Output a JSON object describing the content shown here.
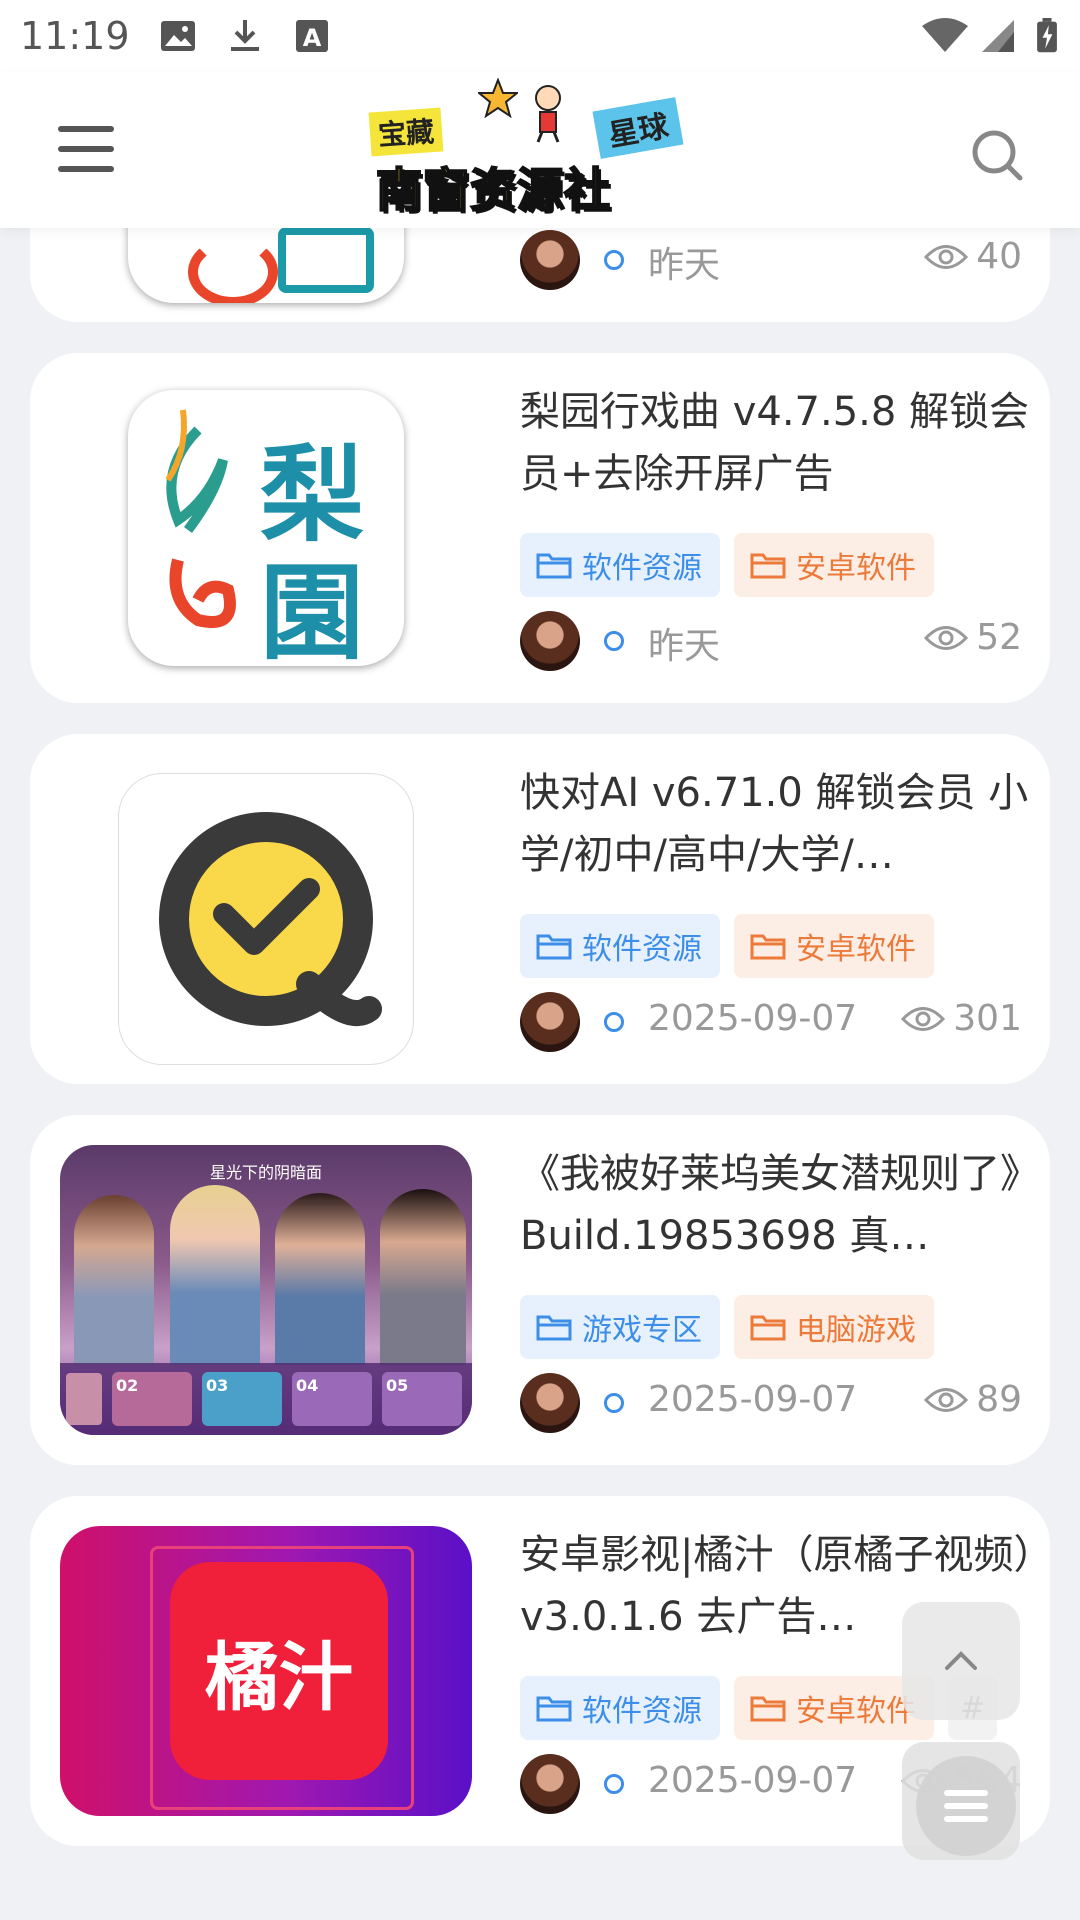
{
  "status_bar": {
    "time": "11:19",
    "icons": [
      "image-icon",
      "download-icon",
      "font-icon",
      "wifi-icon",
      "signal-icon",
      "battery-icon"
    ]
  },
  "header": {
    "logo": {
      "tag_left": "宝藏",
      "tag_right": "星球",
      "main": "南窗资源社"
    }
  },
  "posts": [
    {
      "title": "",
      "date": "昨天",
      "views": "40"
    },
    {
      "title": "梨园行戏曲 v4.7.5.8 解锁会员+去除开屏广告",
      "thumb_text": [
        "梨",
        "園"
      ],
      "tags": [
        "软件资源",
        "安卓软件"
      ],
      "date": "昨天",
      "views": "52"
    },
    {
      "title": "快对AI v6.71.0 解锁会员 小学/初中/高中/大学/…",
      "tags": [
        "软件资源",
        "安卓软件"
      ],
      "date": "2025-09-07",
      "views": "301"
    },
    {
      "title": "《我被好莱坞美女潜规则了》Build.19853698 真…",
      "thumb_caption": "星光下的阴暗面",
      "thumb_slots": [
        "02",
        "03",
        "04",
        "05"
      ],
      "tags": [
        "游戏专区",
        "电脑游戏"
      ],
      "date": "2025-09-07",
      "views": "89"
    },
    {
      "title": "安卓影视|橘汁（原橘子视频）v3.0.1.6 去广告…",
      "thumb_text": "橘汁",
      "tags": [
        "软件资源",
        "安卓软件"
      ],
      "extra_tag": "#",
      "date": "2025-09-07",
      "views": "584"
    }
  ],
  "colors": {
    "accent_blue": "#3c8ee8",
    "accent_orange": "#ec7a3a",
    "background": "#eff1f5"
  }
}
